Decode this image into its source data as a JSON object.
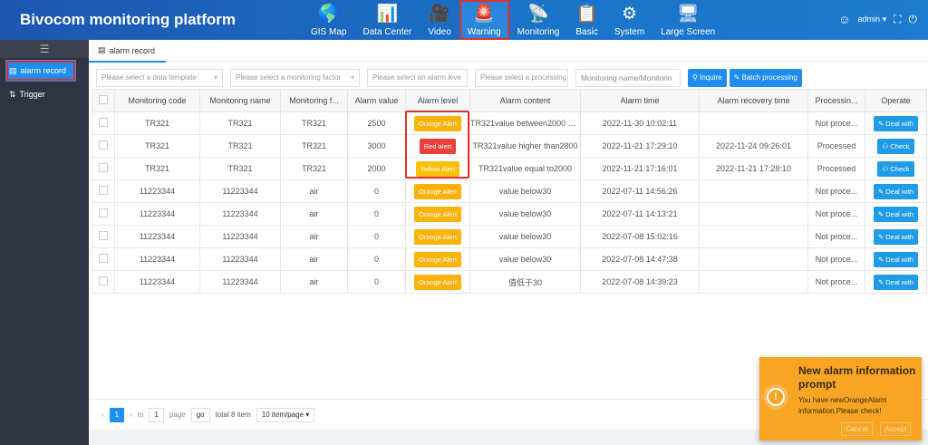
{
  "header": {
    "title": "Bivocom monitoring platform",
    "nav": [
      {
        "label": "GIS Map",
        "icon": "globe-icon",
        "glyph": "🌎"
      },
      {
        "label": "Data Center",
        "icon": "bar-chart-icon",
        "glyph": "📊"
      },
      {
        "label": "Video",
        "icon": "video-icon",
        "glyph": "🎥"
      },
      {
        "label": "Warning",
        "icon": "siren-icon",
        "glyph": "🚨",
        "active": true
      },
      {
        "label": "Monitoring",
        "icon": "satellite-dish-icon",
        "glyph": "📡"
      },
      {
        "label": "Basic",
        "icon": "clipboard-icon",
        "glyph": "📋"
      },
      {
        "label": "System",
        "icon": "gear-icon",
        "glyph": "⚙"
      },
      {
        "label": "Large Screen",
        "icon": "monitor-icon",
        "glyph": "🖥"
      }
    ],
    "user": "admin"
  },
  "sidebar": {
    "items": [
      {
        "label": "alarm record",
        "active": true
      },
      {
        "label": "Trigger"
      }
    ]
  },
  "tab": {
    "label": "alarm record"
  },
  "filters": {
    "data_template": "Please select a data template",
    "monitoring_factor": "Please select a monitoring factor",
    "alarm_level": "Please select an alarm leve",
    "processing": "Please select a processing",
    "search": "Monitoring name/Monitorin",
    "inquire": "Inquire",
    "batch": "Batch processing"
  },
  "table": {
    "columns": [
      "Monitoring code",
      "Monitoring name",
      "Monitoring f...",
      "Alarm value",
      "Alarm level",
      "Alarm content",
      "Alarm time",
      "Alarm recovery time",
      "Processin...",
      "Operate"
    ],
    "rows": [
      [
        "TR321",
        "TR321",
        "TR321",
        "2500",
        "Orange Alert",
        "TR321value between2000 an...",
        "2022-11-30 10:02:11",
        "",
        "Not proce...",
        "Deal with"
      ],
      [
        "TR321",
        "TR321",
        "TR321",
        "3000",
        "Red alert",
        "TR321value higher than2800",
        "2022-11-21 17:29:10",
        "2022-11-24 09:26:01",
        "Processed",
        "Check"
      ],
      [
        "TR321",
        "TR321",
        "TR321",
        "2000",
        "Yellow Alert",
        "TR321value equal to2000",
        "2022-11-21 17:16:01",
        "2022-11-21 17:28:10",
        "Processed",
        "Check"
      ],
      [
        "11223344",
        "11223344",
        "air",
        "0",
        "Orange Alert",
        "value below30",
        "2022-07-11 14:56:26",
        "",
        "Not proce...",
        "Deal with"
      ],
      [
        "11223344",
        "11223344",
        "air",
        "0",
        "Orange Alert",
        "value below30",
        "2022-07-11 14:13:21",
        "",
        "Not proce...",
        "Deal with"
      ],
      [
        "11223344",
        "11223344",
        "air",
        "0",
        "Orange Alert",
        "value below30",
        "2022-07-08 15:02:16",
        "",
        "Not proce...",
        "Deal with"
      ],
      [
        "11223344",
        "11223344",
        "air",
        "0",
        "Orange Alert",
        "value below30",
        "2022-07-08 14:47:38",
        "",
        "Not proce...",
        "Deal with"
      ],
      [
        "11223344",
        "11223344",
        "air",
        "0",
        "Orange Alert",
        "值低于30",
        "2022-07-08 14:39:23",
        "",
        "Not proce...",
        "Deal with"
      ]
    ]
  },
  "level_colors": {
    "Orange Alert": "#fbb20b",
    "Red alert": "#e8413a",
    "Yellow Alert": "#fbc00b"
  },
  "pager": {
    "current": "1",
    "to": "to",
    "page_input": "1",
    "page": "page",
    "go": "go",
    "total": "total 8 item",
    "per_page": "10 item/page"
  },
  "toast": {
    "title": "New alarm information prompt",
    "message": "You have newOrangeAlarm information,Please check!",
    "cancel": "Cancel",
    "accept": "Accept"
  }
}
